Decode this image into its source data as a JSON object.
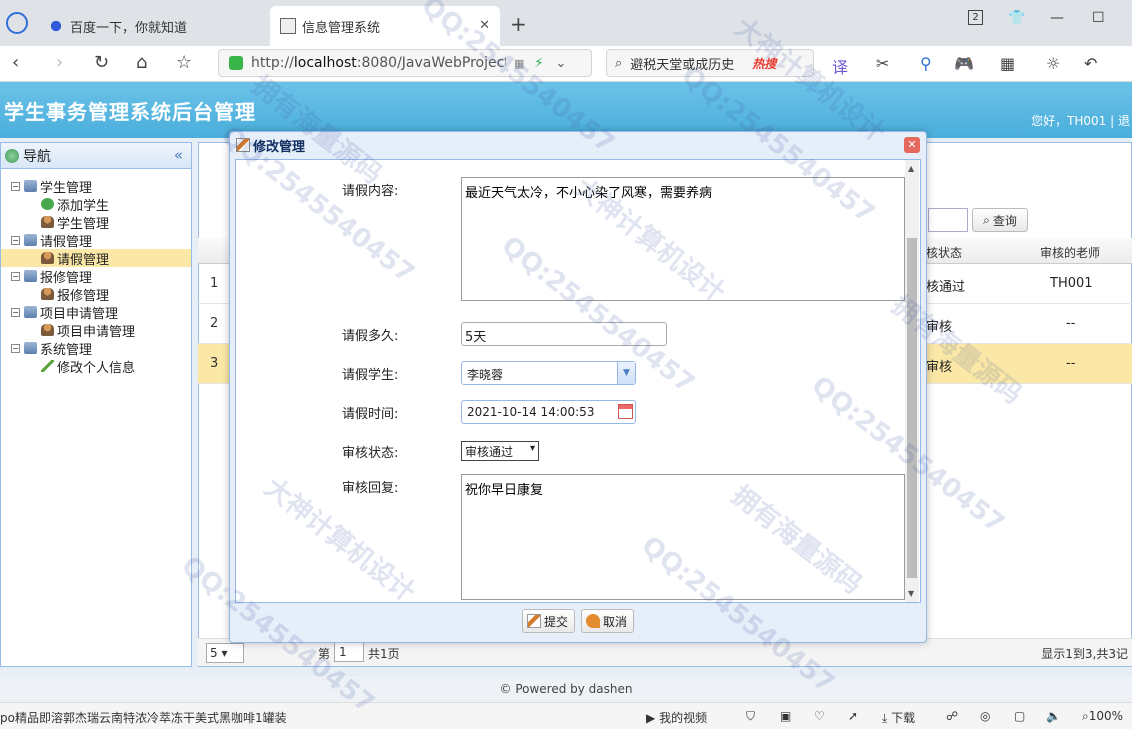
{
  "browser": {
    "tabs": [
      {
        "title": "百度一下，你就知道"
      },
      {
        "title": "信息管理系统"
      }
    ],
    "url_prefix": "http://",
    "url_host": "localhost",
    "url_rest": ":8080/JavaWebProject",
    "search_placeholder": "避税天堂或成历史",
    "hot_label": "热搜",
    "tab_counter": "2"
  },
  "app": {
    "title": "学生事务管理系统后台管理",
    "user_greeting": "您好，TH001 | 退"
  },
  "sidebar": {
    "title": "导航",
    "tree": [
      {
        "label": "学生管理",
        "children": [
          "添加学生",
          "学生管理"
        ]
      },
      {
        "label": "请假管理",
        "children": [
          "请假管理"
        ]
      },
      {
        "label": "报修管理",
        "children": [
          "报修管理"
        ]
      },
      {
        "label": "项目申请管理",
        "children": [
          "项目申请管理"
        ]
      },
      {
        "label": "系统管理",
        "children": [
          "修改个人信息"
        ]
      }
    ]
  },
  "grid": {
    "search_button": "查询",
    "col_status": "核状态",
    "col_teacher": "审核的老师",
    "rows": [
      {
        "num": "1",
        "status": "核通过",
        "teacher": "TH001"
      },
      {
        "num": "2",
        "status": "审核",
        "teacher": "--"
      },
      {
        "num": "3",
        "status": "审核",
        "teacher": "--"
      }
    ],
    "page_size": "5",
    "page_label": "第",
    "page_num": "1",
    "page_total": "共1页",
    "page_info": "显示1到3,共3记"
  },
  "dialog": {
    "title": "修改管理",
    "fields": {
      "reason_label": "请假内容:",
      "reason_value": "最近天气太冷，不小心染了风寒，需要养病",
      "duration_label": "请假多久:",
      "duration_value": "5天",
      "student_label": "请假学生:",
      "student_value": "李晓蓉",
      "time_label": "请假时间:",
      "time_value": "2021-10-14 14:00:53",
      "status_label": "审核状态:",
      "status_value": "审核通过",
      "reply_label": "审核回复:",
      "reply_value": "祝你早日康复"
    },
    "submit_label": "提交",
    "cancel_label": "取消"
  },
  "footer": {
    "text": "© Powered by dashen"
  },
  "statusbar": {
    "ticker": "po精品即溶郭杰瑞云南特浓冷萃冻干美式黑咖啡1罐装",
    "video": "我的视频",
    "download": "下载",
    "zoom": "100%"
  },
  "watermark": {
    "text_qq": "QQ:2545540457",
    "text_cn1": "大神计算机设计",
    "text_cn2": "拥有海量源码"
  }
}
